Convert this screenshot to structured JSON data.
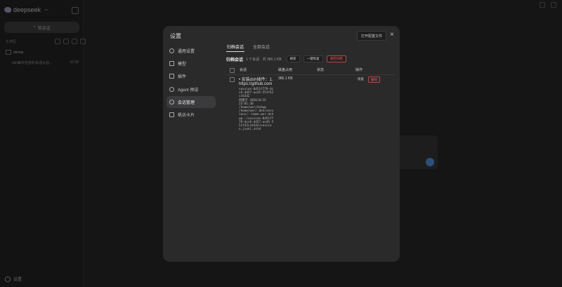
{
  "app": {
    "brand": "deepseek",
    "version_badge": "",
    "new_chat": "新会话",
    "workspace_label": "工作区",
    "workspace_folder": "dshwp",
    "session_title": "dsh每日任务的会话从此...",
    "session_time": "10:38",
    "settings_label": "设置"
  },
  "modal": {
    "title": "设置",
    "open_config": "打开配置文件",
    "close": "×",
    "nav": [
      {
        "label": "通用设置",
        "icon": "gear-icon"
      },
      {
        "label": "模型",
        "icon": "cube-icon"
      },
      {
        "label": "插件",
        "icon": "sliders-icon"
      },
      {
        "label": "Agent 预设",
        "icon": "robot-icon"
      },
      {
        "label": "会话管理",
        "icon": "chat-icon"
      },
      {
        "label": "帆坊卡片",
        "icon": "card-icon"
      }
    ],
    "tabs": [
      {
        "label": "归档会话"
      },
      {
        "label": "全部会话"
      }
    ],
    "section": {
      "title": "归档会话",
      "stats": "1 个会话 · 共 386.1 KB",
      "refresh": "刷新",
      "restore_all": "一键恢复",
      "clear_archive": "清空归档"
    },
    "table": {
      "headers": {
        "session": "会话",
        "size": "磁盘占用",
        "status": "状态",
        "actions": "操作"
      },
      "rows": [
        {
          "title": "• 安装dsh插件：1.",
          "url": "https://github.com",
          "meta": "session-8d51f779-dc\nc6-4d57-acd5-551f42\ncc63d2\n创建于 2026/8/15\n23:01:30\n/home/wer/dshwp\n/home/wer/.dsh/sess\nions/--home-wer-dsh\nwp--/session-8d51f7\n79-dcc6-4d57-acd5-5\n51f42cc63d2/sessio\nn.jsonl.zstd",
          "size": "386.1 KB",
          "status": "",
          "restore": "恢复",
          "delete": "删除"
        }
      ]
    }
  }
}
